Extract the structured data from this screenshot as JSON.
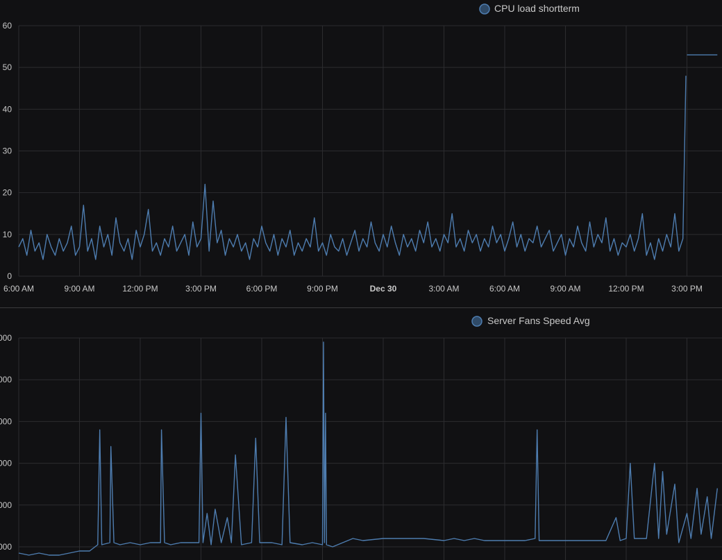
{
  "colors": {
    "background": "#111113",
    "grid": "#2c2c2f",
    "axis_text": "#c9c9c9",
    "series": "#4e7db0",
    "legend_dot_fill": "#2f4a67"
  },
  "chart_data": [
    {
      "type": "line",
      "title": "",
      "legend": {
        "entries": [
          "CPU load shortterm"
        ],
        "placement": "top-right"
      },
      "xlabel": "",
      "ylabel": "",
      "grid": true,
      "x_ticks": [
        "6:00 AM",
        "9:00 AM",
        "12:00 PM",
        "3:00 PM",
        "6:00 PM",
        "9:00 PM",
        "Dec 30",
        "3:00 AM",
        "6:00 AM",
        "9:00 AM",
        "12:00 PM",
        "3:00 PM"
      ],
      "x_ticks_bold": [
        "Dec 30"
      ],
      "x_range_hours": [
        0,
        34.5
      ],
      "y_ticks": [
        "0",
        "10",
        "20",
        "30",
        "40",
        "50",
        "60"
      ],
      "ylim": [
        0,
        60
      ],
      "series": [
        {
          "name": "CPU load shortterm",
          "points": [
            [
              0,
              7
            ],
            [
              0.2,
              9
            ],
            [
              0.4,
              5
            ],
            [
              0.6,
              11
            ],
            [
              0.8,
              6
            ],
            [
              1,
              8
            ],
            [
              1.2,
              4
            ],
            [
              1.4,
              10
            ],
            [
              1.6,
              7
            ],
            [
              1.8,
              5
            ],
            [
              2,
              9
            ],
            [
              2.2,
              6
            ],
            [
              2.4,
              8
            ],
            [
              2.6,
              12
            ],
            [
              2.8,
              5
            ],
            [
              3,
              7
            ],
            [
              3.2,
              17
            ],
            [
              3.4,
              6
            ],
            [
              3.6,
              9
            ],
            [
              3.8,
              4
            ],
            [
              4,
              12
            ],
            [
              4.2,
              7
            ],
            [
              4.4,
              10
            ],
            [
              4.6,
              5
            ],
            [
              4.8,
              14
            ],
            [
              5,
              8
            ],
            [
              5.2,
              6
            ],
            [
              5.4,
              9
            ],
            [
              5.6,
              4
            ],
            [
              5.8,
              11
            ],
            [
              6,
              7
            ],
            [
              6.2,
              10
            ],
            [
              6.4,
              16
            ],
            [
              6.6,
              6
            ],
            [
              6.8,
              8
            ],
            [
              7,
              5
            ],
            [
              7.2,
              9
            ],
            [
              7.4,
              7
            ],
            [
              7.6,
              12
            ],
            [
              7.8,
              6
            ],
            [
              8,
              8
            ],
            [
              8.2,
              10
            ],
            [
              8.4,
              5
            ],
            [
              8.6,
              13
            ],
            [
              8.8,
              7
            ],
            [
              9,
              9
            ],
            [
              9.2,
              22
            ],
            [
              9.4,
              6
            ],
            [
              9.6,
              18
            ],
            [
              9.8,
              8
            ],
            [
              10,
              11
            ],
            [
              10.2,
              5
            ],
            [
              10.4,
              9
            ],
            [
              10.6,
              7
            ],
            [
              10.8,
              10
            ],
            [
              11,
              6
            ],
            [
              11.2,
              8
            ],
            [
              11.4,
              4
            ],
            [
              11.6,
              9
            ],
            [
              11.8,
              7
            ],
            [
              12,
              12
            ],
            [
              12.2,
              8
            ],
            [
              12.4,
              6
            ],
            [
              12.6,
              10
            ],
            [
              12.8,
              5
            ],
            [
              13,
              9
            ],
            [
              13.2,
              7
            ],
            [
              13.4,
              11
            ],
            [
              13.6,
              5
            ],
            [
              13.8,
              8
            ],
            [
              14,
              6
            ],
            [
              14.2,
              9
            ],
            [
              14.4,
              7
            ],
            [
              14.6,
              14
            ],
            [
              14.8,
              6
            ],
            [
              15,
              8
            ],
            [
              15.2,
              5
            ],
            [
              15.4,
              10
            ],
            [
              15.6,
              7
            ],
            [
              15.8,
              6
            ],
            [
              16,
              9
            ],
            [
              16.2,
              5
            ],
            [
              16.4,
              8
            ],
            [
              16.6,
              11
            ],
            [
              16.8,
              6
            ],
            [
              17,
              9
            ],
            [
              17.2,
              7
            ],
            [
              17.4,
              13
            ],
            [
              17.6,
              8
            ],
            [
              17.8,
              6
            ],
            [
              18,
              10
            ],
            [
              18.2,
              7
            ],
            [
              18.4,
              12
            ],
            [
              18.6,
              8
            ],
            [
              18.8,
              5
            ],
            [
              19,
              10
            ],
            [
              19.2,
              7
            ],
            [
              19.4,
              9
            ],
            [
              19.6,
              6
            ],
            [
              19.8,
              11
            ],
            [
              20,
              8
            ],
            [
              20.2,
              13
            ],
            [
              20.4,
              7
            ],
            [
              20.6,
              9
            ],
            [
              20.8,
              6
            ],
            [
              21,
              10
            ],
            [
              21.2,
              8
            ],
            [
              21.4,
              15
            ],
            [
              21.6,
              7
            ],
            [
              21.8,
              9
            ],
            [
              22,
              6
            ],
            [
              22.2,
              11
            ],
            [
              22.4,
              8
            ],
            [
              22.6,
              10
            ],
            [
              22.8,
              6
            ],
            [
              23,
              9
            ],
            [
              23.2,
              7
            ],
            [
              23.4,
              12
            ],
            [
              23.6,
              8
            ],
            [
              23.8,
              10
            ],
            [
              24,
              6
            ],
            [
              24.2,
              9
            ],
            [
              24.4,
              13
            ],
            [
              24.6,
              7
            ],
            [
              24.8,
              10
            ],
            [
              25,
              6
            ],
            [
              25.2,
              9
            ],
            [
              25.4,
              8
            ],
            [
              25.6,
              12
            ],
            [
              25.8,
              7
            ],
            [
              26,
              9
            ],
            [
              26.2,
              11
            ],
            [
              26.4,
              6
            ],
            [
              26.6,
              8
            ],
            [
              26.8,
              10
            ],
            [
              27,
              5
            ],
            [
              27.2,
              9
            ],
            [
              27.4,
              7
            ],
            [
              27.6,
              12
            ],
            [
              27.8,
              8
            ],
            [
              28,
              6
            ],
            [
              28.2,
              13
            ],
            [
              28.4,
              7
            ],
            [
              28.6,
              10
            ],
            [
              28.8,
              8
            ],
            [
              29,
              14
            ],
            [
              29.2,
              6
            ],
            [
              29.4,
              9
            ],
            [
              29.6,
              5
            ],
            [
              29.8,
              8
            ],
            [
              30,
              7
            ],
            [
              30.2,
              10
            ],
            [
              30.4,
              6
            ],
            [
              30.6,
              9
            ],
            [
              30.8,
              15
            ],
            [
              31,
              5
            ],
            [
              31.2,
              8
            ],
            [
              31.4,
              4
            ],
            [
              31.6,
              9
            ],
            [
              31.8,
              6
            ],
            [
              32,
              10
            ],
            [
              32.2,
              7
            ],
            [
              32.4,
              15
            ],
            [
              32.6,
              6
            ],
            [
              32.8,
              9
            ],
            [
              32.95,
              48
            ]
          ]
        },
        {
          "name": "CPU load shortterm",
          "points": [
            [
              33.0,
              53
            ],
            [
              34.5,
              53
            ]
          ]
        }
      ]
    },
    {
      "type": "line",
      "title": "",
      "legend": {
        "entries": [
          "Server Fans Speed Avg"
        ],
        "placement": "top-right"
      },
      "xlabel": "",
      "ylabel": "",
      "grid": true,
      "x_range_hours": [
        0,
        34.5
      ],
      "y_ticks": [
        "000",
        "000",
        "000",
        "000",
        "000",
        "000"
      ],
      "y_index_range": [
        0,
        5
      ],
      "series": [
        {
          "name": "Server Fans Speed Avg",
          "points": [
            [
              0,
              -0.15
            ],
            [
              0.5,
              -0.2
            ],
            [
              1,
              -0.15
            ],
            [
              1.5,
              -0.2
            ],
            [
              2,
              -0.2
            ],
            [
              2.5,
              -0.15
            ],
            [
              3,
              -0.1
            ],
            [
              3.5,
              -0.1
            ],
            [
              3.9,
              0.05
            ],
            [
              4.0,
              2.8
            ],
            [
              4.1,
              0.05
            ],
            [
              4.5,
              0.1
            ],
            [
              4.55,
              2.4
            ],
            [
              4.7,
              0.1
            ],
            [
              5,
              0.05
            ],
            [
              5.5,
              0.1
            ],
            [
              6,
              0.05
            ],
            [
              6.5,
              0.1
            ],
            [
              7.0,
              0.1
            ],
            [
              7.05,
              2.8
            ],
            [
              7.2,
              0.1
            ],
            [
              7.5,
              0.05
            ],
            [
              8,
              0.1
            ],
            [
              8.5,
              0.1
            ],
            [
              8.9,
              0.1
            ],
            [
              9.0,
              3.2
            ],
            [
              9.1,
              0.1
            ],
            [
              9.3,
              0.8
            ],
            [
              9.5,
              0.05
            ],
            [
              9.7,
              0.9
            ],
            [
              10,
              0.1
            ],
            [
              10.3,
              0.7
            ],
            [
              10.5,
              0.1
            ],
            [
              10.7,
              2.2
            ],
            [
              11,
              0.05
            ],
            [
              11.5,
              0.1
            ],
            [
              11.7,
              2.6
            ],
            [
              11.9,
              0.1
            ],
            [
              12.5,
              0.1
            ],
            [
              13,
              0.05
            ],
            [
              13.2,
              3.1
            ],
            [
              13.4,
              0.1
            ],
            [
              14,
              0.05
            ],
            [
              14.5,
              0.1
            ],
            [
              15.0,
              0.05
            ],
            [
              15.05,
              4.9
            ],
            [
              15.1,
              0.1
            ],
            [
              15.15,
              3.2
            ],
            [
              15.2,
              0.05
            ],
            [
              15.5,
              0
            ],
            [
              16.0,
              0.1
            ],
            [
              16.5,
              0.2
            ],
            [
              17,
              0.15
            ],
            [
              18,
              0.2
            ],
            [
              19,
              0.2
            ],
            [
              20,
              0.2
            ],
            [
              21,
              0.15
            ],
            [
              21.5,
              0.2
            ],
            [
              22,
              0.15
            ],
            [
              22.5,
              0.2
            ],
            [
              23,
              0.15
            ],
            [
              24,
              0.15
            ],
            [
              25,
              0.15
            ],
            [
              25.5,
              0.2
            ],
            [
              25.6,
              2.8
            ],
            [
              25.7,
              0.15
            ],
            [
              26,
              0.15
            ],
            [
              27,
              0.15
            ],
            [
              28,
              0.15
            ],
            [
              29,
              0.15
            ],
            [
              29.5,
              0.7
            ],
            [
              29.7,
              0.15
            ],
            [
              30,
              0.2
            ],
            [
              30.2,
              2.0
            ],
            [
              30.4,
              0.2
            ],
            [
              31,
              0.2
            ],
            [
              31.4,
              2.0
            ],
            [
              31.6,
              0.2
            ],
            [
              31.8,
              1.8
            ],
            [
              32,
              0.3
            ],
            [
              32.4,
              1.5
            ],
            [
              32.6,
              0.1
            ],
            [
              33,
              0.8
            ],
            [
              33.2,
              0.2
            ],
            [
              33.5,
              1.4
            ],
            [
              33.7,
              0.3
            ],
            [
              34,
              1.2
            ],
            [
              34.2,
              0.2
            ],
            [
              34.5,
              1.4
            ]
          ]
        }
      ]
    }
  ]
}
